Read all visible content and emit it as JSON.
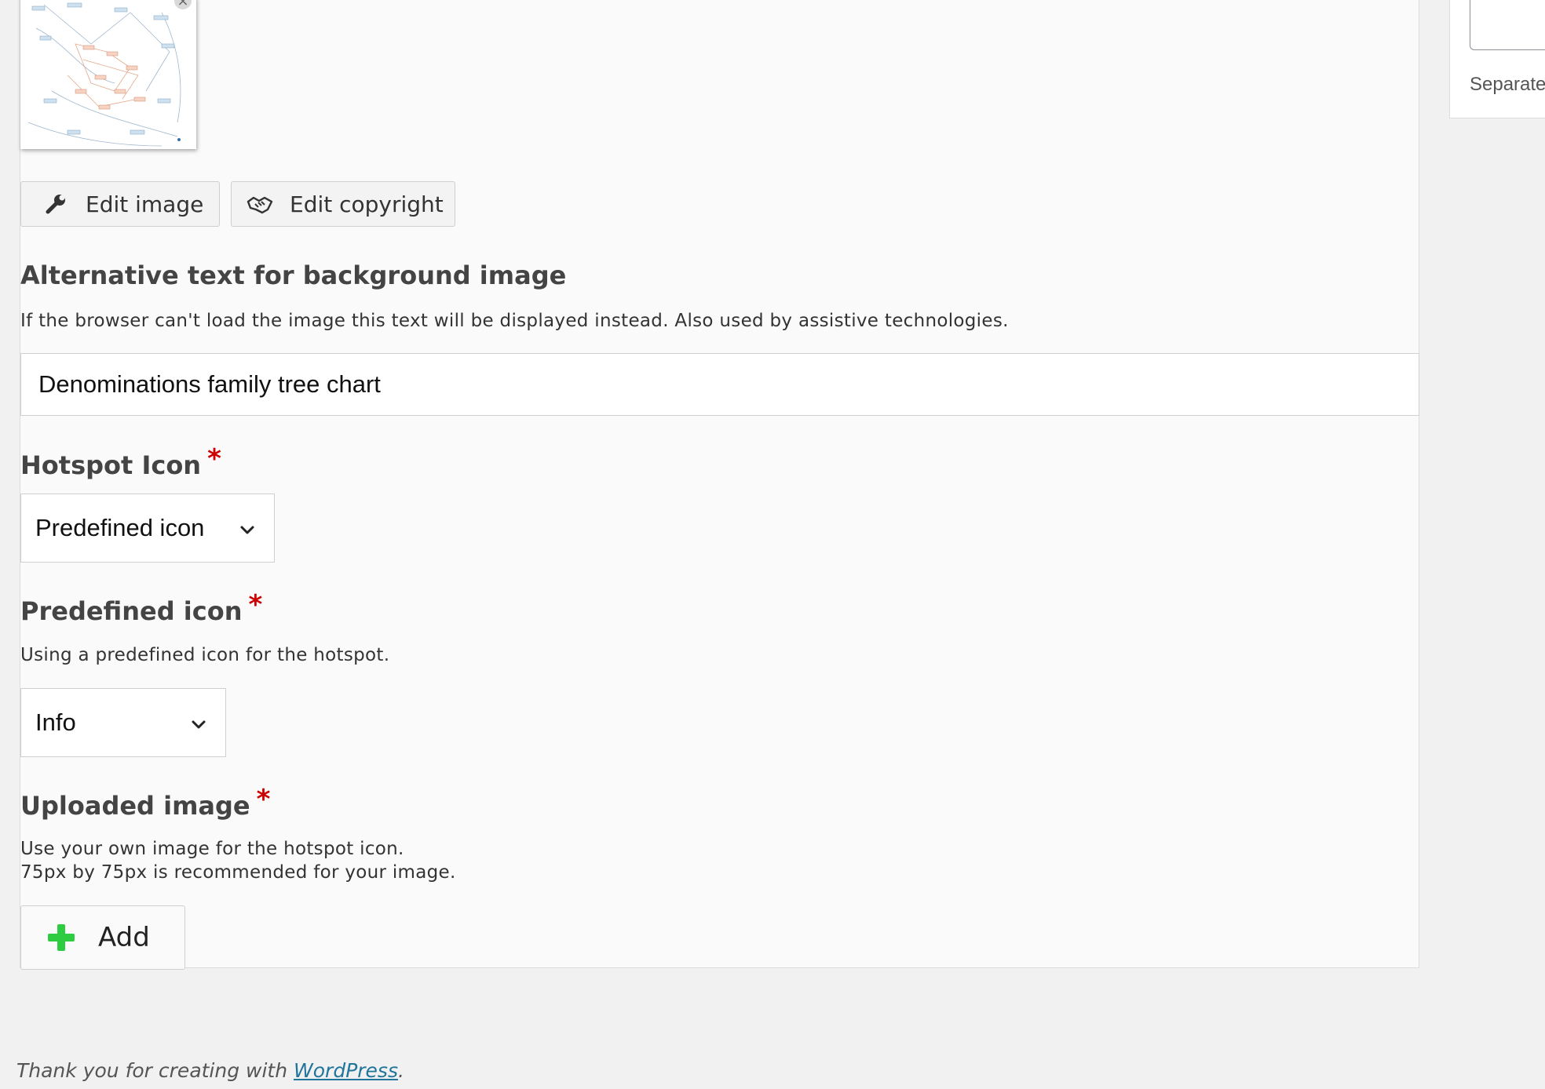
{
  "sidebar": {
    "label": "Separate"
  },
  "thumbnail": {
    "remove_symbol": "×"
  },
  "buttons": {
    "edit_image": "Edit image",
    "edit_copyright": "Edit copyright"
  },
  "alt_text": {
    "label": "Alternative text for background image",
    "description": "If the browser can't load the image this text will be displayed instead. Also used by assistive technologies.",
    "value": "Denominations family tree chart"
  },
  "hotspot_icon": {
    "label": "Hotspot Icon",
    "selected": "Predefined icon"
  },
  "predefined_icon": {
    "label": "Predefined icon",
    "description": "Using a predefined icon for the hotspot.",
    "selected": "Info"
  },
  "uploaded_image": {
    "label": "Uploaded image",
    "description_line1": "Use your own image for the hotspot icon.",
    "description_line2": "75px by 75px is recommended for your image.",
    "add_label": "Add"
  },
  "required_marker": "*",
  "footer": {
    "prefix": "Thank you for creating with ",
    "link": "WordPress",
    "suffix": "."
  },
  "colors": {
    "required": "#cc0000",
    "add_icon": "#2ecc40",
    "link": "#21759b",
    "panel_bg": "#fafafa",
    "page_bg": "#f1f1f1"
  },
  "icons": [
    "wrench-icon",
    "handshake-icon",
    "chevron-down-icon",
    "plus-icon",
    "close-icon"
  ]
}
